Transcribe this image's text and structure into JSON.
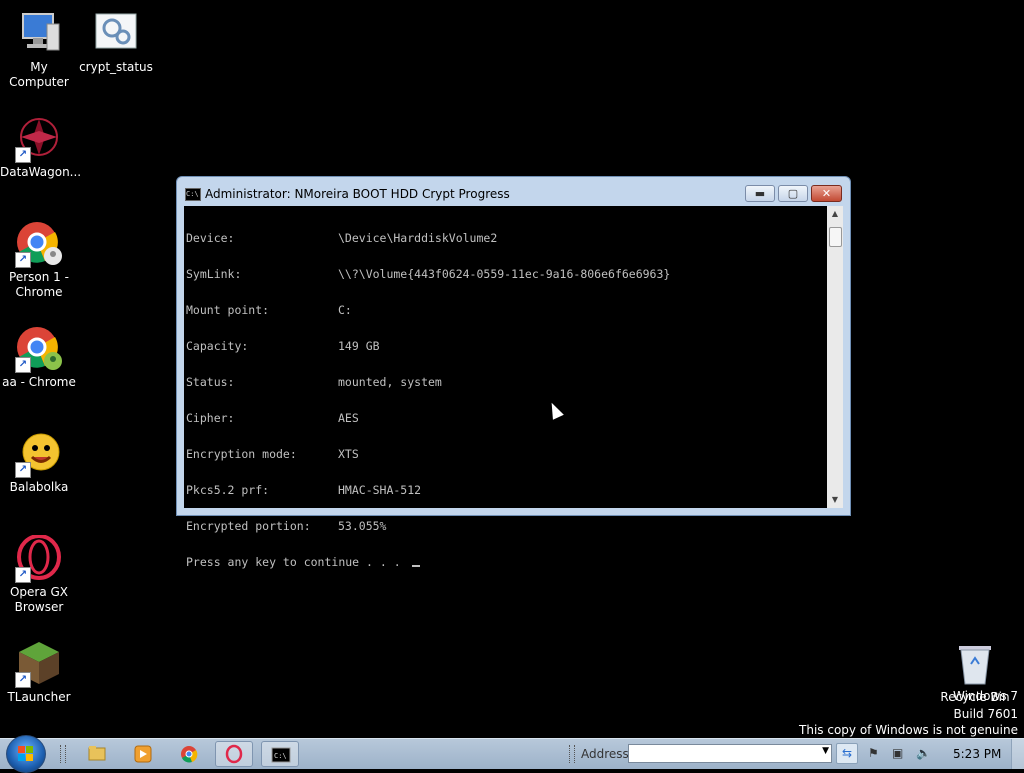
{
  "desktop": {
    "icons": [
      {
        "label": "My Computer",
        "icon": "computer-icon",
        "shortcut": false
      },
      {
        "label": "crypt_status",
        "icon": "settings-file-icon",
        "shortcut": false
      },
      {
        "label": "DataWagon...",
        "icon": "datawagon-icon",
        "shortcut": true
      },
      {
        "label": "Person 1 - Chrome",
        "icon": "chrome-icon",
        "shortcut": true
      },
      {
        "label": "aa - Chrome",
        "icon": "chrome-icon",
        "shortcut": true
      },
      {
        "label": "Balabolka",
        "icon": "balabolka-icon",
        "shortcut": true
      },
      {
        "label": "Opera GX Browser",
        "icon": "opera-gx-icon",
        "shortcut": true
      },
      {
        "label": "TLauncher",
        "icon": "minecraft-icon",
        "shortcut": true
      },
      {
        "label": "Recycle Bin",
        "icon": "recycle-bin-icon",
        "shortcut": false
      }
    ]
  },
  "window": {
    "title": "Administrator:  NMoreira BOOT HDD Crypt Progress",
    "controls": {
      "minimize": "▬",
      "maximize": "▢",
      "close": "✕"
    },
    "console": {
      "rows": [
        {
          "key": "Device:",
          "value": "\\Device\\HarddiskVolume2"
        },
        {
          "key": "SymLink:",
          "value": "\\\\?\\Volume{443f0624-0559-11ec-9a16-806e6f6e6963}"
        },
        {
          "key": "Mount point:",
          "value": "C:"
        },
        {
          "key": "Capacity:",
          "value": "149 GB"
        },
        {
          "key": "Status:",
          "value": "mounted, system"
        },
        {
          "key": "Cipher:",
          "value": "AES"
        },
        {
          "key": "Encryption mode:",
          "value": "XTS"
        },
        {
          "key": "Pkcs5.2 prf:",
          "value": "HMAC-SHA-512"
        },
        {
          "key": "Encrypted portion:",
          "value": "53.055%"
        }
      ],
      "prompt": "Press any key to continue . . . "
    }
  },
  "watermark": {
    "line1": "Windows 7",
    "line2": "Build 7601",
    "line3": "This copy of Windows is not genuine"
  },
  "taskbar": {
    "address_label": "Address",
    "address_value": "",
    "clock": "5:23 PM",
    "pinned": [
      "explorer-icon",
      "media-player-icon",
      "chrome-icon",
      "opera-gx-icon",
      "cmd-icon"
    ]
  }
}
